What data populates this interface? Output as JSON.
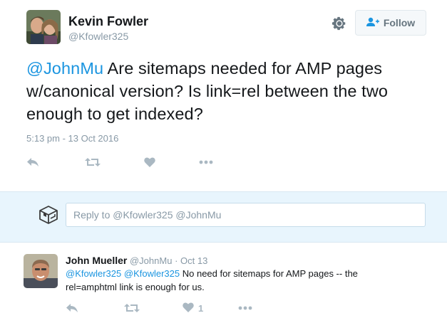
{
  "tweet": {
    "author_name": "Kevin Fowler",
    "author_handle": "@Kfowler325",
    "mention": "@JohnMu",
    "text_rest": " Are sitemaps needed for AMP pages w/canonical version? Is link=rel between the two enough to get indexed?",
    "timestamp": "5:13 pm - 13 Oct 2016",
    "follow_label": "Follow"
  },
  "icons": {
    "gear": "gear-icon",
    "follow": "add-user-icon",
    "reply": "reply-icon",
    "retweet": "retweet-icon",
    "like": "heart-icon",
    "more": "more-icon"
  },
  "reply_box": {
    "placeholder": "Reply to @Kfowler325 @JohnMu"
  },
  "reply": {
    "author_name": "John Mueller",
    "author_handle": "@JohnMu",
    "separator": "·",
    "date": "Oct 13",
    "mention1": "@Kfowler325",
    "mention2": "@Kfowler325",
    "text_rest": " No need for sitemaps for AMP pages -- the rel=amphtml link is enough for us.",
    "like_count": "1"
  },
  "colors": {
    "accent": "#1b95e0",
    "muted": "#8899a6",
    "reply_bg": "#e8f5fd"
  }
}
